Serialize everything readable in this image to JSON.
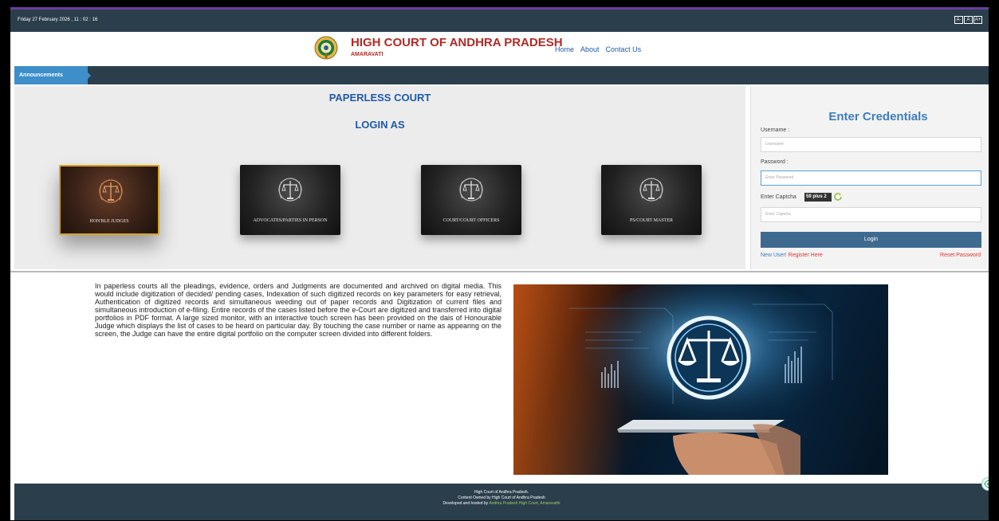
{
  "topbar": {
    "datetime": "Friday 27 February 2026 , 11  :  02  :  16",
    "font_buttons": [
      "A-",
      "A",
      "A+"
    ]
  },
  "header": {
    "title": "HIGH COURT OF ANDHRA PRADESH",
    "subtitle": "AMARAVATI",
    "nav": [
      "Home",
      "About",
      "Contact Us"
    ]
  },
  "announcements": {
    "label": "Announcements"
  },
  "login_section": {
    "heading": "PAPERLESS COURT",
    "subheading": "LOGIN AS",
    "roles": [
      {
        "label": "HON'BLE JUDGES",
        "active": true
      },
      {
        "label": "ADVOCATES/PARTIES IN PERSON",
        "active": false
      },
      {
        "label": "COURT/COURT OFFICERS",
        "active": false
      },
      {
        "label": "PS/COURT MASTER",
        "active": false
      }
    ]
  },
  "credentials": {
    "title": "Enter Credentials",
    "username_label": "Username :",
    "username_placeholder": "Username",
    "password_label": "Password :",
    "password_placeholder": "Enter Password",
    "captcha_label": "Enter Captcha",
    "captcha_value": "59 plus 2",
    "captcha_placeholder": "Enter Captcha",
    "login_button": "Login",
    "new_user_text": "New User!",
    "register_link": "Register Here",
    "reset_link": "Reset Password"
  },
  "description": "In paperless courts all the pleadings, evidence, orders and Judgments are documented and archived on digital media. This would include digitization of decided/ pending cases, Indexation of such digitized records on key parameters for easy retrieval, Authentication of digitized records and simultaneous weeding out of paper records and Digitization of current files and simultaneous introduction of e-filing. Entire records of the cases listed before the e-Court are digitized and transferred into digital portfolios in PDF format. A large sized monitor, with an interactive touch screen has been provided on the dais of Honourable Judge which displays the list of cases to be heard on particular day. By touching the case number or name as appearing on the screen, the Judge can have the entire digital portfolio on the computer screen divided into different folders.",
  "footer": {
    "line1": "High Court of Andhra Pradesh.",
    "line2": "Content Owned by High Court of Andhra Pradesh",
    "line3_prefix": "Developed and hosted by",
    "line3_dev": "Andhra Pradesh High Court, Amaravathi"
  },
  "colors": {
    "topbar": "#2b3e4c",
    "title": "#b22a25",
    "link": "#1f5aa8",
    "accent": "#3d8ec9",
    "danger": "#d33333"
  },
  "icons": [
    "emblem-icon",
    "scales-of-justice-icon",
    "refresh-icon",
    "chat-icon"
  ]
}
